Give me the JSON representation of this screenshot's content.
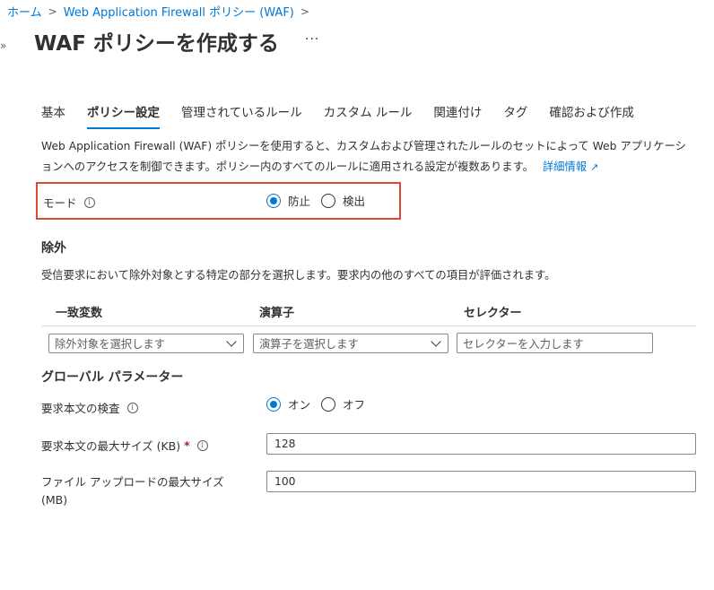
{
  "breadcrumb": {
    "home": "ホーム",
    "parent": "Web Application Firewall ポリシー (WAF)"
  },
  "page": {
    "title": "WAF ポリシーを作成する",
    "more": "···"
  },
  "tabs": [
    {
      "label": "基本"
    },
    {
      "label": "ポリシー設定"
    },
    {
      "label": "管理されているルール"
    },
    {
      "label": "カスタム ルール"
    },
    {
      "label": "関連付け"
    },
    {
      "label": "タグ"
    },
    {
      "label": "確認および作成"
    }
  ],
  "description": {
    "text": "Web Application Firewall (WAF) ポリシーを使用すると、カスタムおよび管理されたルールのセットによって Web アプリケーションへのアクセスを制御できます。ポリシー内のすべてのルールに適用される設定が複数あります。",
    "link": "詳細情報"
  },
  "mode": {
    "label": "モード",
    "option1": "防止",
    "option2": "検出",
    "selected": "防止"
  },
  "exclusions": {
    "heading": "除外",
    "description": "受信要求において除外対象とする特定の部分を選択します。要求内の他のすべての項目が評価されます。",
    "col1": "一致変数",
    "col2": "演算子",
    "col3": "セレクター",
    "var_placeholder": "除外対象を選択します",
    "op_placeholder": "演算子を選択します",
    "selector_placeholder": "セレクターを入力します"
  },
  "global": {
    "heading": "グローバル パラメーター",
    "inspect_label": "要求本文の検査",
    "on": "オン",
    "off": "オフ",
    "inspect_selected": "オン",
    "max_body_label": "要求本文の最大サイズ (KB)",
    "required_mark": "*",
    "max_body_value": "128",
    "upload_label_line1": "ファイル アップロードの最大サイズ",
    "upload_label_line2": "(MB)",
    "upload_value": "100"
  },
  "icons": {
    "info": "info-icon",
    "external": "external-link-icon",
    "chevron": "chevron-down-icon"
  },
  "colors": {
    "accent": "#0078d4",
    "highlight": "#e04a2f"
  }
}
